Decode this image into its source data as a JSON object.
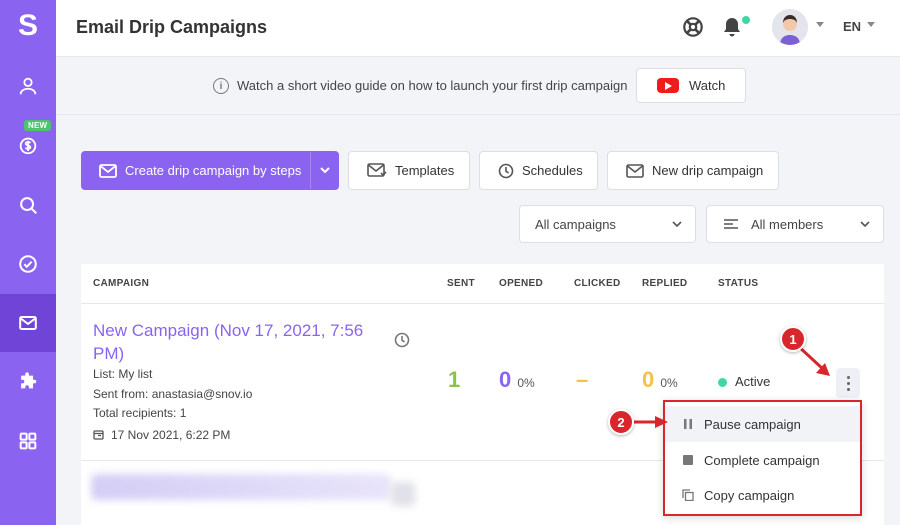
{
  "app": {
    "logo": "S",
    "title": "Email Drip Campaigns",
    "language": "EN"
  },
  "sidebar": {
    "new_badge": "NEW",
    "items": [
      {
        "icon": "user-icon"
      },
      {
        "icon": "dollar-icon"
      },
      {
        "icon": "search-icon"
      },
      {
        "icon": "check-circle-icon"
      },
      {
        "icon": "mail-icon",
        "active": true
      },
      {
        "icon": "puzzle-icon"
      },
      {
        "icon": "grid-icon"
      }
    ]
  },
  "banner": {
    "text": "Watch a short video guide on how to launch your first drip campaign",
    "watch_label": "Watch"
  },
  "toolbar": {
    "create_label": "Create drip campaign by steps",
    "templates_label": "Templates",
    "schedules_label": "Schedules",
    "new_campaign_label": "New drip campaign"
  },
  "filters": {
    "campaigns_value": "All campaigns",
    "members_value": "All members"
  },
  "table": {
    "columns": [
      "CAMPAIGN",
      "SENT",
      "OPENED",
      "CLICKED",
      "REPLIED",
      "STATUS"
    ],
    "row": {
      "name": "New Campaign (Nov 17, 2021, 7:56 PM)",
      "list": "List: My list",
      "sent_from": "Sent from: anastasia@snov.io",
      "total_recipients": "Total recipients: 1",
      "date": "17 Nov 2021, 6:22 PM",
      "sent": "1",
      "opened": "0",
      "opened_pct": "0%",
      "clicked": "–",
      "replied": "0",
      "replied_pct": "0%",
      "status": "Active"
    }
  },
  "menu": {
    "pause_label": "Pause campaign",
    "complete_label": "Complete campaign",
    "copy_label": "Copy campaign"
  },
  "annotations": {
    "marker1": "1",
    "marker2": "2"
  },
  "colors": {
    "brand": "#8a63f0",
    "sent": "#8bc34a",
    "opened": "#8a63f0",
    "clicked": "#f5c242",
    "replied": "#f5c242",
    "status_active": "#3ed7a5",
    "annotation": "#d9262c"
  }
}
